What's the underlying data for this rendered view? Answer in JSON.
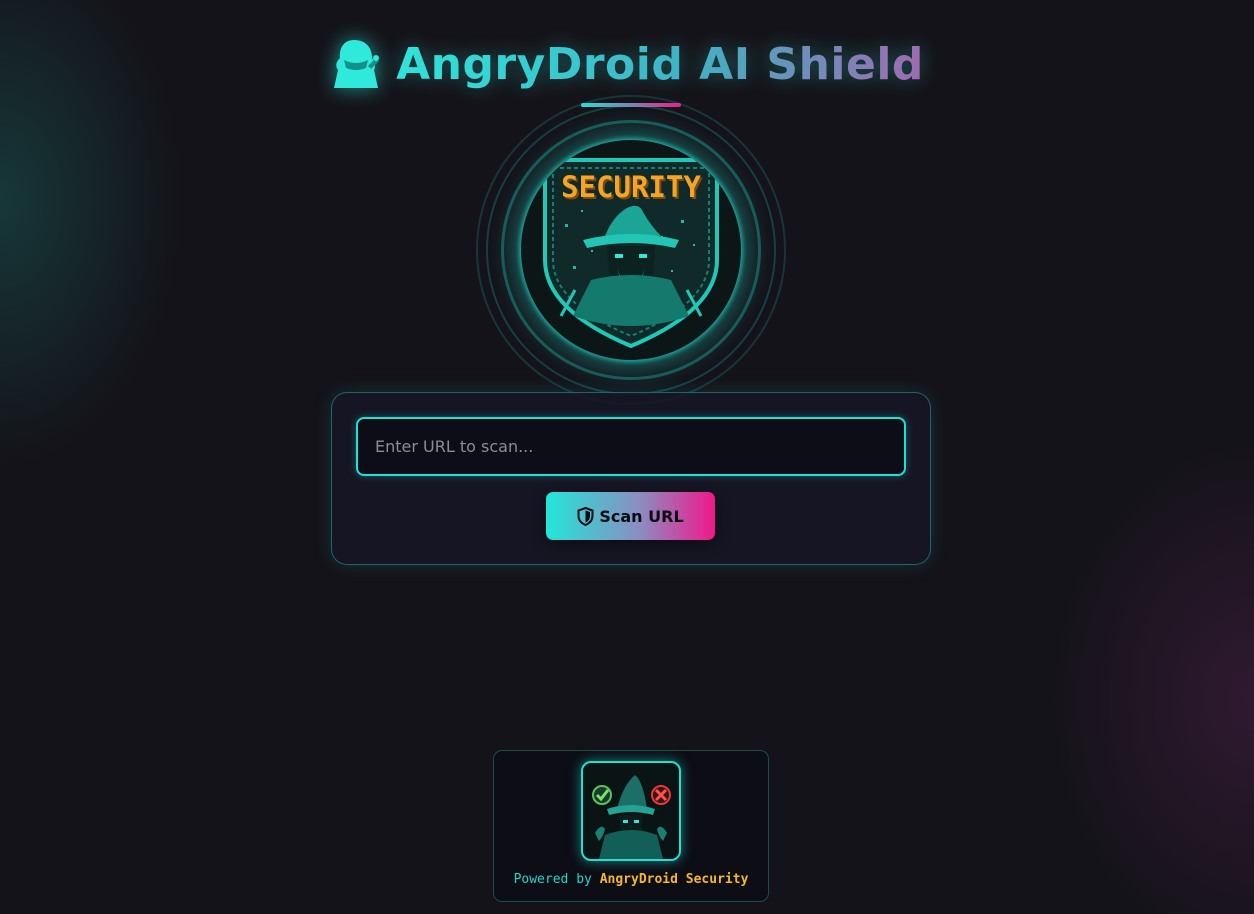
{
  "header": {
    "icon": "hooded-figure-icon",
    "title": "AngryDroid AI Shield"
  },
  "emblem": {
    "word": "SECURITY",
    "icon": "wizard-shield-icon"
  },
  "scan": {
    "placeholder": "Enter URL to scan...",
    "value": "",
    "button_icon": "shield-icon",
    "button_label": "Scan URL"
  },
  "footer": {
    "logo_icon": "wizard-check-cross-icon",
    "prefix": "Powered by",
    "brand": "AngryDroid Security"
  },
  "colors": {
    "background": "#141319",
    "accent_cyan": "#1fe0d3",
    "accent_pink": "#ee1a8d",
    "gold": "#f5b82a"
  }
}
